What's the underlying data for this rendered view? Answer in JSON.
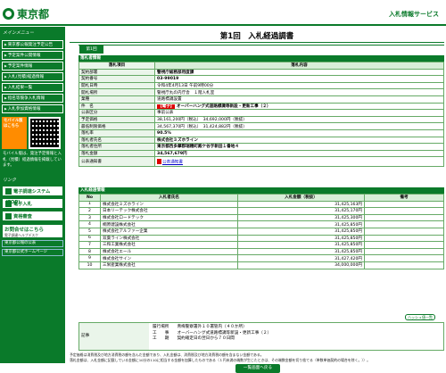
{
  "header": {
    "logo": "東京都",
    "service": "入札情報サービス"
  },
  "sidebar": {
    "menu_head": "メインメニュー",
    "items": [
      "東京都公報発注予定公告",
      "予定案件公開情報",
      "予定案件情報",
      "入札(見積)経過情報",
      "入札結果一覧",
      "指名等競争入札情報",
      "入札参加資格情報"
    ],
    "mobile_badge": "モバイル版はこちら",
    "mobile_text": "モバイル版は、発注予定情報と入札（見積）経過情報を掲載しています。",
    "links_head": "リンク",
    "big_links": [
      "電子調達システム(TOP)",
      "電子入札",
      "資格審査"
    ],
    "help_title": "お問合せはこちら",
    "help_sub": "電子調達ヘルプデスク",
    "ext_links": [
      "東京都公報の公表",
      "東京都公式ホームページ"
    ]
  },
  "main": {
    "title": "第1回　入札経過調書",
    "tab": "第1回",
    "section1": "落札者情報",
    "info_head": [
      "落札項目",
      "落札内容"
    ],
    "info": [
      {
        "label": "契約部署",
        "value": "警視庁総務部用度課"
      },
      {
        "label": "契約番号",
        "value": "03-99019"
      },
      {
        "label": "開札日時",
        "value": "令和4年4月13日 午前9時00分"
      },
      {
        "label": "開札場所",
        "value": "警視庁丸の内庁舎　１階入札室"
      },
      {
        "label": "業種",
        "value": "道路標識設置"
      },
      {
        "label": "件　名",
        "tag": "【電子】",
        "value": "オーバーハング式道路標識等新設・更新工事（２）"
      },
      {
        "label": "公表区分",
        "value": "事前公表"
      },
      {
        "label": "予定価格",
        "value": "38,161,200円（税込）　34,692,000円（税抜）"
      },
      {
        "label": "最低制限価格",
        "value": "34,567,370円（税込）　31,424,882円（税抜）"
      },
      {
        "label": "落札率",
        "value": "90.5%"
      },
      {
        "label": "落札者氏名",
        "value": "株式会社ミズホライン"
      },
      {
        "label": "落札者住所",
        "value": "東京都西多摩郡瑞穂町殿ケ谷字新田１番地４"
      },
      {
        "label": "落札金額",
        "value": "34,567,679円"
      },
      {
        "label": "公表通知書",
        "value": "公表通知書"
      }
    ],
    "section2": "入札経過情報",
    "bid_head": [
      "No",
      "入札者氏名",
      "入札金額（税抜）",
      "備考"
    ],
    "bids": [
      [
        "1",
        "株式会社ミズホライン",
        "31,425,163円",
        ""
      ],
      [
        "2",
        "日本リーテック株式会社",
        "31,425,170円",
        ""
      ],
      [
        "3",
        "株式会社ロードテック",
        "31,425,300円",
        ""
      ],
      [
        "4",
        "桐原建設株式会社",
        "31,425,850円",
        ""
      ],
      [
        "5",
        "株式会社アルファー企業",
        "31,425,850円",
        ""
      ],
      [
        "6",
        "双葉ライン株式会社",
        "31,425,850円",
        ""
      ],
      [
        "7",
        "三和工業株式会社",
        "31,425,850円",
        ""
      ],
      [
        "8",
        "株式会社エール",
        "31,425,850円",
        ""
      ],
      [
        "9",
        "株式会社サイン",
        "31,427,420円",
        ""
      ],
      [
        "10",
        "三栄産業株式会社",
        "34,000,000円",
        ""
      ]
    ],
    "page_button": "ハッシュ値一覧",
    "remarks_label": "記事",
    "remarks": "履行場所　　青梅警察署外１０署管内（４０か所）\n工　　事　　オーバーハング式道路標識等新設・更新工事（２）\n工　　期　　契約確定日の翌日から７０日間",
    "note": "予定価格は消費税及び地方消費税の額を含んだ金額であり、入札金額は、消費税及び地方消費税の額を含まない金額である。\n落札金額は、入札金額に記載している金額に10分の110に相当する金額を加算したものである（１円未満の端数が生じたときは、その端数金額を切り捨てる（単数単価契約の場合を除く。））。",
    "back_button": "一覧画面へ戻る"
  }
}
